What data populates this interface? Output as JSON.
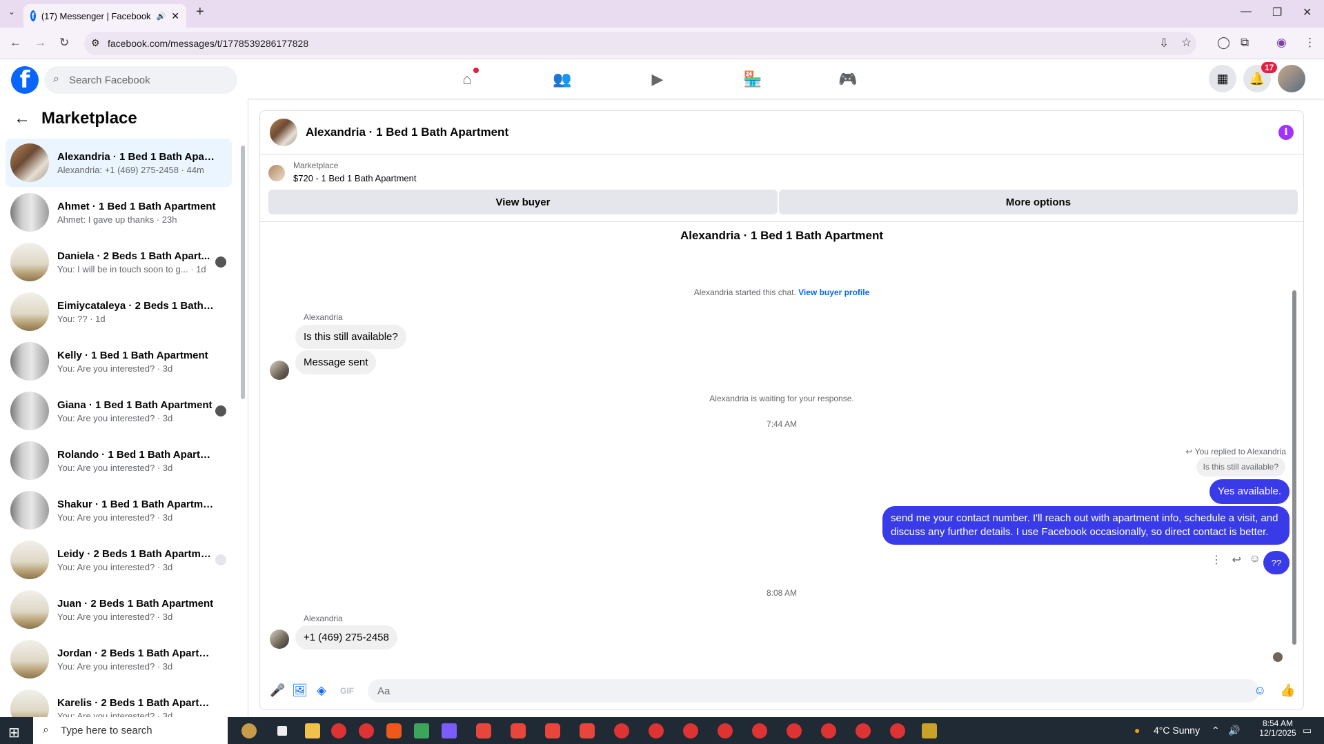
{
  "browser": {
    "tab_title": "(17) Messenger | Facebook",
    "url": "facebook.com/messages/t/1778539286177828"
  },
  "facebook": {
    "search_placeholder": "Search Facebook",
    "notification_count": "17"
  },
  "sidebar": {
    "title": "Marketplace",
    "conversations": [
      {
        "title": "Alexandria · 1 Bed 1 Bath Apart...",
        "subtitle": "Alexandria: +1 (469) 275-2458 · 44m",
        "thumb": "alex"
      },
      {
        "title": "Ahmet · 1 Bed 1 Bath Apartment",
        "subtitle": "Ahmet: I gave up thanks · 23h",
        "thumb": "apt"
      },
      {
        "title": "Daniela · 2 Beds 1 Bath Apart...",
        "subtitle": "You: I will be in touch soon to g... · 1d",
        "thumb": "room"
      },
      {
        "title": "Eimiycataleya · 2 Beds 1 Bath Ap...",
        "subtitle": "You: ?? · 1d",
        "thumb": "room"
      },
      {
        "title": "Kelly · 1 Bed 1 Bath Apartment",
        "subtitle": "You: Are you interested? · 3d",
        "thumb": "apt"
      },
      {
        "title": "Giana · 1 Bed 1 Bath Apartment",
        "subtitle": "You: Are you interested? · 3d",
        "thumb": "apt"
      },
      {
        "title": "Rolando · 1 Bed 1 Bath Apartment",
        "subtitle": "You: Are you interested? · 3d",
        "thumb": "apt"
      },
      {
        "title": "Shakur · 1 Bed 1 Bath Apartment",
        "subtitle": "You: Are you interested? · 3d",
        "thumb": "apt"
      },
      {
        "title": "Leidy · 2 Beds 1 Bath Apartment",
        "subtitle": "You: Are you interested? · 3d",
        "thumb": "room"
      },
      {
        "title": "Juan · 2 Beds 1 Bath Apartment",
        "subtitle": "You: Are you interested? · 3d",
        "thumb": "room"
      },
      {
        "title": "Jordan · 2 Beds 1 Bath Apartment",
        "subtitle": "You: Are you interested? · 3d",
        "thumb": "room"
      },
      {
        "title": "Karelis · 2 Beds 1 Bath Apartment",
        "subtitle": "You: Are you interested? · 3d",
        "thumb": "room"
      }
    ]
  },
  "chat": {
    "header_title": "Alexandria · 1 Bed 1 Bath Apartment",
    "marketplace_label": "Marketplace",
    "listing": "$720 - 1 Bed 1 Bath Apartment",
    "view_buyer_label": "View buyer",
    "more_options_label": "More options",
    "intro_name": "Alexandria · 1 Bed 1 Bath Apartment",
    "started_text": "Alexandria started this chat.",
    "view_profile_link": "View buyer profile",
    "sender1": "Alexandria",
    "msg1": "Is this still available?",
    "msg2": "Message sent",
    "waiting_text": "Alexandria is waiting for your response.",
    "time1": "7:44 AM",
    "replied_label": "You replied to Alexandria",
    "quoted": "Is this still available?",
    "out1": "Yes available.",
    "out2": "send me your contact number. I'll reach out with apartment info, schedule a visit, and discuss any further details. I use Facebook occasionally, so direct contact is better.",
    "out3": "??",
    "time2": "8:08 AM",
    "sender2": "Alexandria",
    "msg3": "+1 (469) 275-2458",
    "input_placeholder": "Aa"
  },
  "taskbar": {
    "search_placeholder": "Type here to search",
    "weather": "4°C  Sunny",
    "time": "8:54 AM",
    "date": "12/1/2025"
  },
  "colors": {
    "brand": "#0866ff",
    "outgoing": "#3a3be8",
    "info": "#a033ff"
  }
}
